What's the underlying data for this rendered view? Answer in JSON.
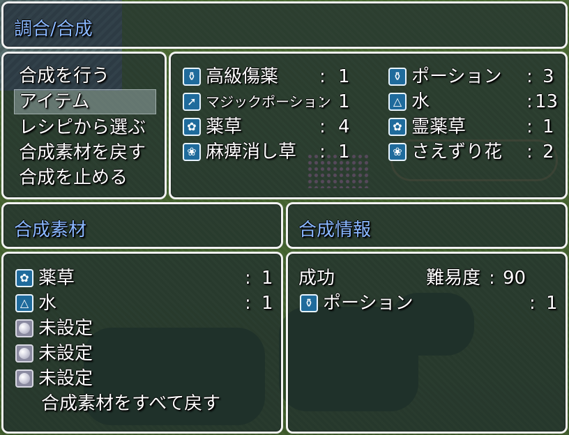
{
  "header": {
    "title": "調合/合成"
  },
  "command_menu": {
    "items": [
      {
        "label": "合成を行う"
      },
      {
        "label": "アイテム",
        "selected": true
      },
      {
        "label": "レシピから選ぶ"
      },
      {
        "label": "合成素材を戻す"
      },
      {
        "label": "合成を止める"
      }
    ]
  },
  "inventory": {
    "colon": ":",
    "items": [
      {
        "icon": "potion-flask-icon",
        "name": "高級傷薬",
        "qty": "1"
      },
      {
        "icon": "potion-flask-icon",
        "name": "ポーション",
        "qty": "3"
      },
      {
        "icon": "wand-icon",
        "name": "マジックポーション",
        "qty": "1"
      },
      {
        "icon": "water-jar-icon",
        "name": "水",
        "qty": "13"
      },
      {
        "icon": "herb-icon",
        "name": "薬草",
        "qty": "4"
      },
      {
        "icon": "herb-icon",
        "name": "霊薬草",
        "qty": "1"
      },
      {
        "icon": "flower-icon",
        "name": "麻痺消し草",
        "qty": "1"
      },
      {
        "icon": "flower-icon",
        "name": "さえずり花",
        "qty": "2"
      }
    ]
  },
  "materials": {
    "title": "合成素材",
    "colon": ":",
    "slots": [
      {
        "icon": "herb-icon",
        "name": "薬草",
        "qty": "1"
      },
      {
        "icon": "water-jar-icon",
        "name": "水",
        "qty": "1"
      },
      {
        "icon": "empty-orb-icon",
        "name": "未設定"
      },
      {
        "icon": "empty-orb-icon",
        "name": "未設定"
      },
      {
        "icon": "empty-orb-icon",
        "name": "未設定"
      }
    ],
    "return_all_label": "合成素材をすべて戻す"
  },
  "info": {
    "title": "合成情報",
    "status": "成功",
    "difficulty_label": "難易度",
    "difficulty_value": "90",
    "colon": ":",
    "result": {
      "icon": "potion-flask-icon",
      "name": "ポーション",
      "qty": "1"
    }
  },
  "colors": {
    "title_blue": "#8ab8ff",
    "window_border": "#f2f2f2",
    "icon_blue": "#1f6b9c"
  }
}
